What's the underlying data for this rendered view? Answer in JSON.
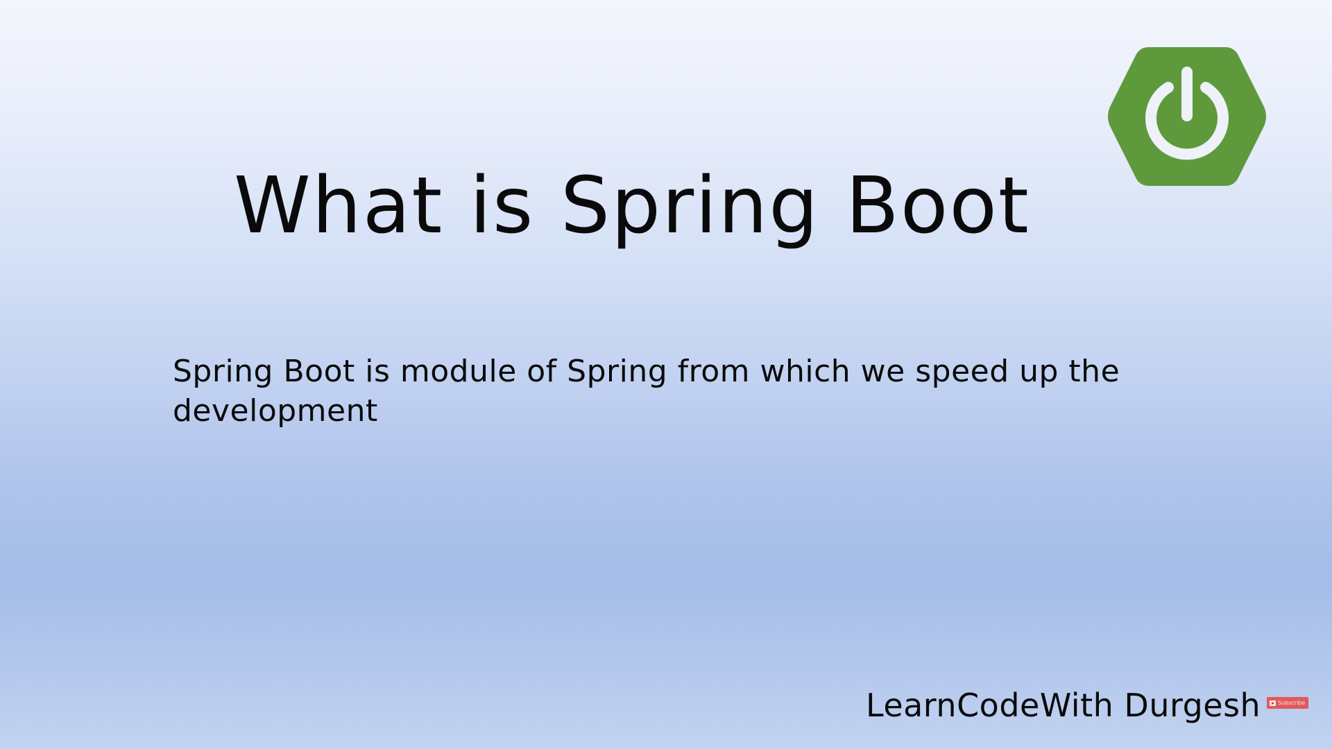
{
  "slide": {
    "title": "What is Spring Boot",
    "body": "Spring Boot is module of Spring from which we speed up the development",
    "footer": "LearnCodeWith Durgesh"
  },
  "logo": {
    "icon": "spring-boot-power-icon",
    "color": "#5e9a3c"
  },
  "subscribe": {
    "label": "Subscribe",
    "color": "#e05a5a"
  }
}
